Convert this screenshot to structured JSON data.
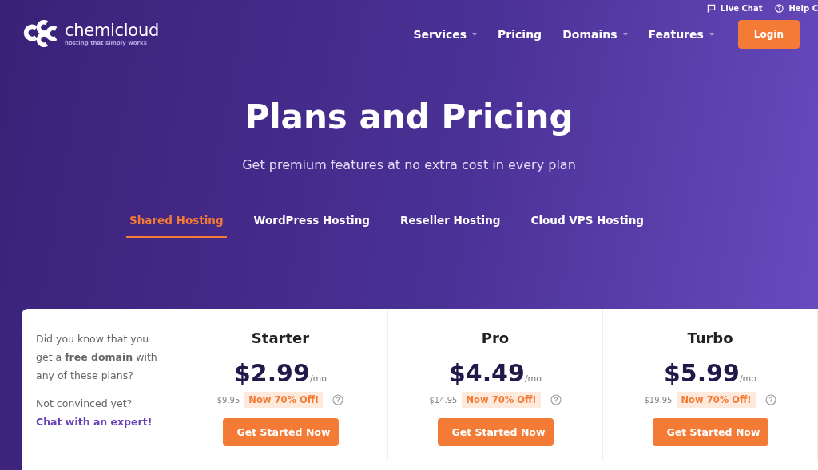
{
  "top_links": [
    {
      "kind": "chat",
      "label": "Live Chat"
    },
    {
      "kind": "help",
      "label": "Help C"
    }
  ],
  "logo": {
    "name": "chemicloud",
    "tagline": "hosting that simply works"
  },
  "nav": [
    {
      "label": "Services",
      "dropdown": true
    },
    {
      "label": "Pricing",
      "dropdown": false
    },
    {
      "label": "Domains",
      "dropdown": true
    },
    {
      "label": "Features",
      "dropdown": true
    }
  ],
  "login": "Login",
  "hero": {
    "title": "Plans and Pricing",
    "subtitle": "Get premium features at no extra cost in every plan"
  },
  "tabs": [
    {
      "label": "Shared Hosting",
      "selected": true
    },
    {
      "label": "WordPress Hosting",
      "selected": false
    },
    {
      "label": "Reseller Hosting",
      "selected": false
    },
    {
      "label": "Cloud VPS Hosting",
      "selected": false
    }
  ],
  "info": {
    "text": "Did you know that you get a **free domain** with any of these plans?",
    "question": "Not convinced yet?",
    "link": "Chat with an expert!"
  },
  "plans": [
    {
      "name": "Starter",
      "price": "$2.99",
      "period": "/mo",
      "old_price": "$9.95",
      "discount": "Now 70% Off!",
      "button": "Get Started Now"
    },
    {
      "name": "Pro",
      "price": "$4.49",
      "period": "/mo",
      "old_price": "$14.95",
      "discount": "Now 70% Off!",
      "button": "Get Started Now"
    },
    {
      "name": "Turbo",
      "price": "$5.99",
      "period": "/mo",
      "old_price": "$19.95",
      "discount": "Now 70% Off!",
      "button": "Get Started Now"
    }
  ]
}
